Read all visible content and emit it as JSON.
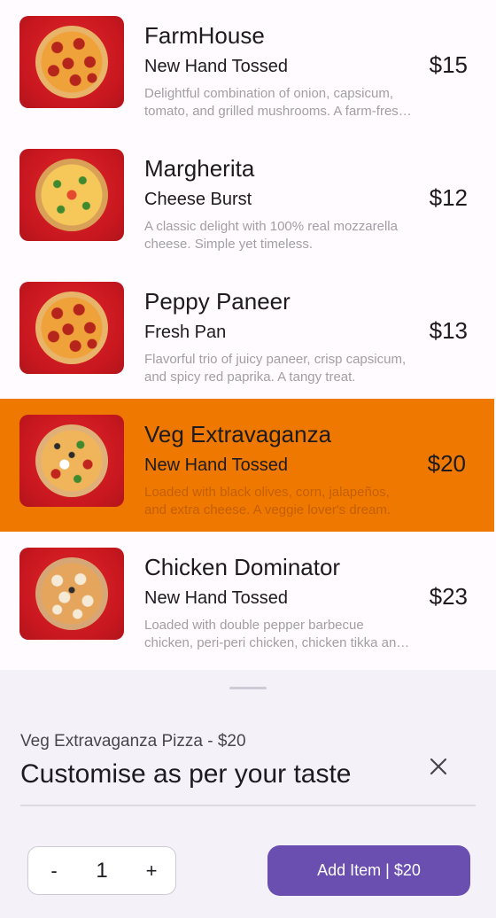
{
  "menu": {
    "items": [
      {
        "name": "FarmHouse",
        "crust": "New Hand Tossed",
        "description": "Delightful combination of onion, capsicum, tomato, and grilled mushrooms. A farm-fresh favourite.",
        "price": "$15",
        "image_icon": "pepperoni-pizza-icon",
        "selected": false
      },
      {
        "name": "Margherita",
        "crust": "Cheese Burst",
        "description": "A classic delight with 100% real mozzarella cheese. Simple yet timeless.",
        "price": "$12",
        "image_icon": "margherita-pizza-icon",
        "selected": false
      },
      {
        "name": "Peppy Paneer",
        "crust": "Fresh Pan",
        "description": "Flavorful trio of juicy paneer, crisp capsicum, and spicy red paprika. A tangy treat.",
        "price": "$13",
        "image_icon": "pepperoni-pizza-icon",
        "selected": false
      },
      {
        "name": "Veg Extravaganza",
        "crust": "New Hand Tossed",
        "description": "Loaded with black olives, corn, jalapeños, and extra cheese. A veggie lover's dream.",
        "price": "$20",
        "image_icon": "veg-pizza-icon",
        "selected": true
      },
      {
        "name": "Chicken Dominator",
        "crust": "New Hand Tossed",
        "description": "Loaded with double pepper barbecue chicken, peri-peri chicken, chicken tikka and more.",
        "price": "$23",
        "image_icon": "chicken-pizza-icon",
        "selected": false
      }
    ]
  },
  "sheet": {
    "subtitle": "Veg Extravaganza Pizza - $20",
    "title": "Customise as per your taste",
    "close_icon": "close-icon",
    "stepper": {
      "minus_label": "-",
      "value": "1",
      "plus_label": "+"
    },
    "add_button_label": "Add Item | $20"
  },
  "colors": {
    "selected_row": "#ef7801",
    "primary_button": "#6a4fb1",
    "sheet_background": "#f4f2f8"
  }
}
